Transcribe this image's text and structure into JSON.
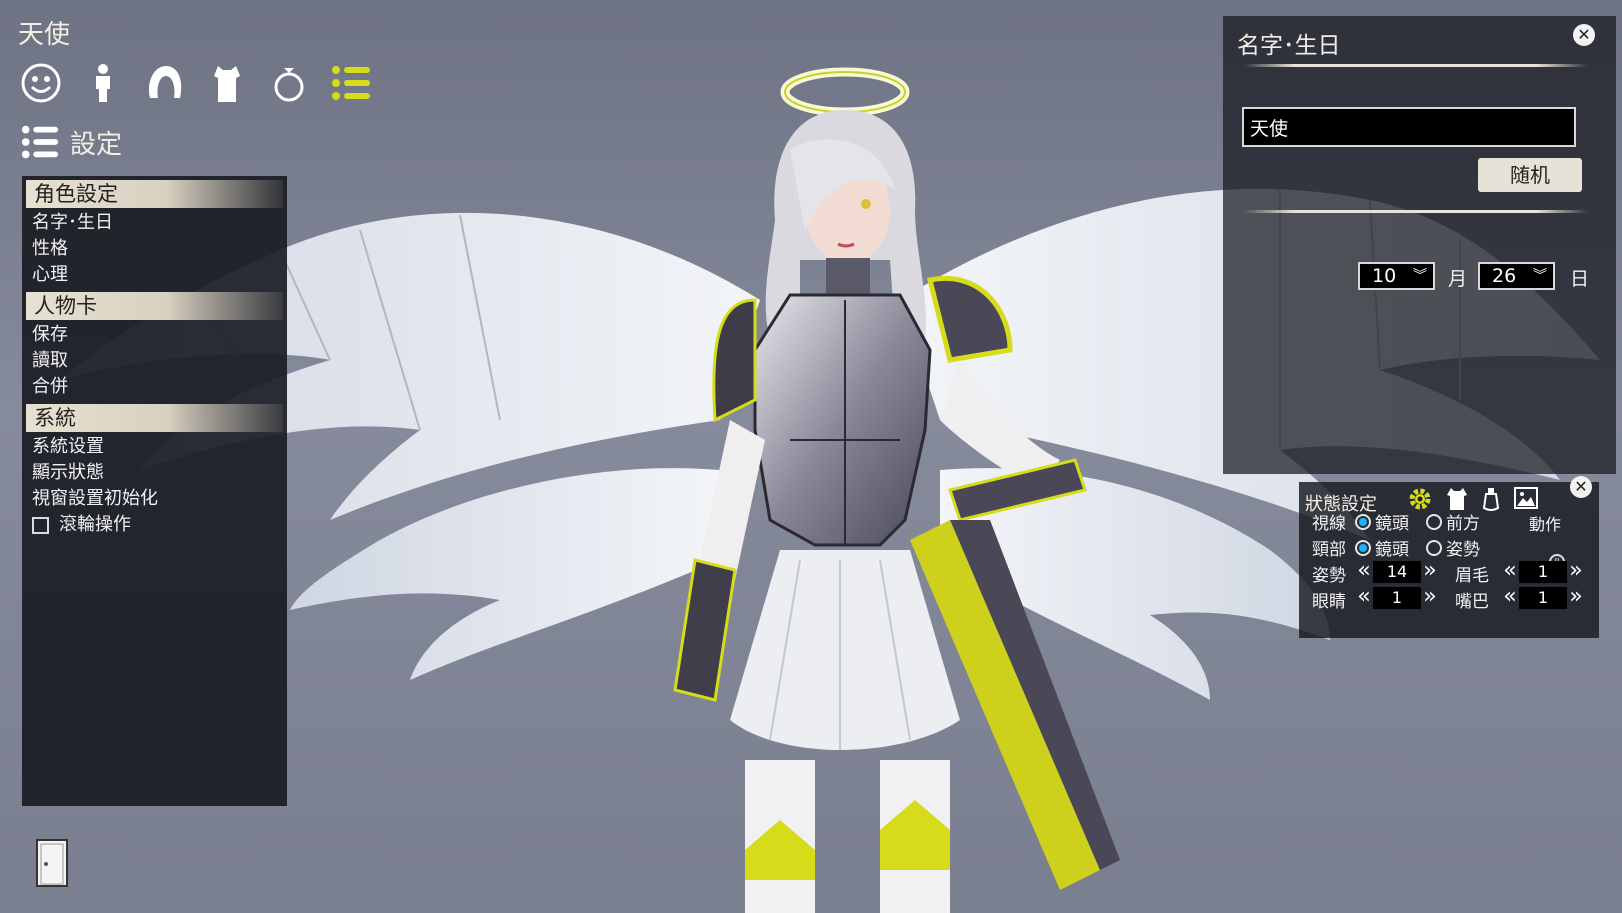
{
  "window": {
    "title": "天使"
  },
  "toolbar": {
    "icons": [
      "face-icon",
      "body-icon",
      "hair-icon",
      "clothes-icon",
      "accessory-icon",
      "list-icon"
    ],
    "active": "list-icon",
    "accent": "#d6dc1a"
  },
  "settings": {
    "label": "設定"
  },
  "menu": {
    "sections": [
      {
        "label": "角色設定",
        "items": [
          "名字･生日",
          "性格",
          "心理"
        ]
      },
      {
        "label": "人物卡",
        "items": [
          "保存",
          "讀取",
          "合併"
        ]
      },
      {
        "label": "系統",
        "items": [
          "系統设置",
          "顯示狀態",
          "視窗設置初始化"
        ]
      }
    ],
    "checkbox": {
      "label": "滾輪操作",
      "checked": false
    }
  },
  "name_panel": {
    "title": "名字･生日",
    "name_value": "天使",
    "random_label": "随机",
    "month": "10",
    "month_unit": "月",
    "day": "26",
    "day_unit": "日"
  },
  "status_panel": {
    "title": "狀態設定",
    "gaze": {
      "label": "視線",
      "opt1": "鏡頭",
      "opt2": "前方",
      "selected": "鏡頭"
    },
    "head": {
      "label": "頸部",
      "opt1": "鏡頭",
      "opt2": "姿勢",
      "selected": "鏡頭"
    },
    "motion_label": "動作",
    "pose": {
      "label": "姿勢",
      "value": "14"
    },
    "eyebrow": {
      "label": "眉毛",
      "value": "1"
    },
    "eyes": {
      "label": "眼睛",
      "value": "1"
    },
    "mouth": {
      "label": "嘴巴",
      "value": "1"
    }
  }
}
